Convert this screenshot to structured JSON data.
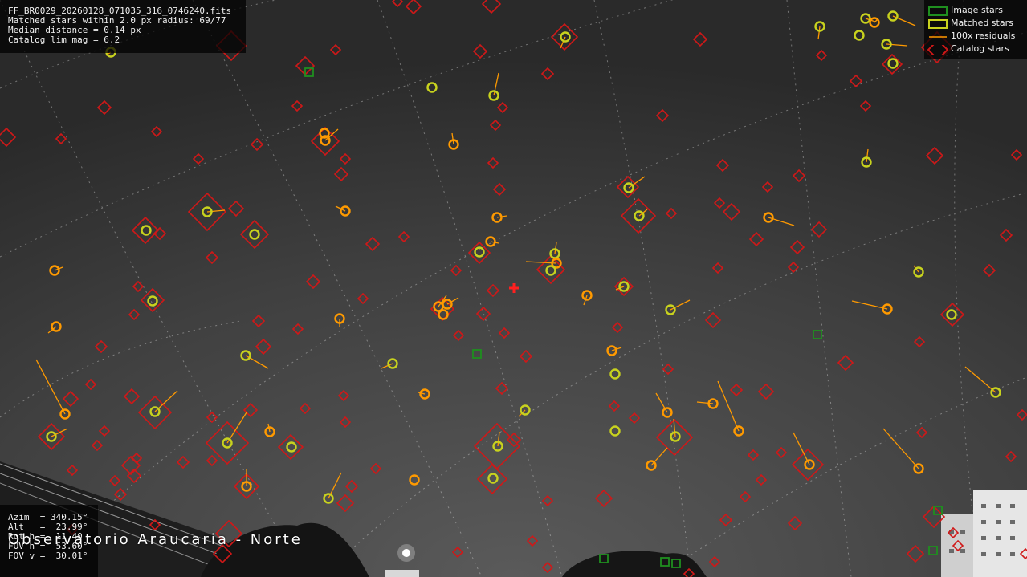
{
  "header": {
    "filename": "FF_BR0029_20260128_071035_316_0746240.fits",
    "matched_line": "Matched stars within 2.0 px radius: 69/77",
    "median_line": "Median distance = 0.14 px",
    "limmag_line": "Catalog lim mag = 6.2"
  },
  "legend": {
    "image_stars": "Image stars",
    "matched_stars": "Matched stars",
    "residuals": "100x residuals",
    "catalog_stars": "Catalog stars"
  },
  "pointing": {
    "azim": "Azim  = 340.15°",
    "alt": "Alt   =  23.99°",
    "rotn": "Rot h =  11.40",
    "fovh": "FOV h =  53.60°",
    "fovv": "FOV v =  30.01°"
  },
  "station_label": "Observatorio Araucaria - Norte",
  "colors": {
    "image_star": "#1f8f1f",
    "matched_star": "#c8d21e",
    "residual": "#ff9a00",
    "catalog_star": "#d01818",
    "center_marker": "#ff2020",
    "grid": "#cfcfcf"
  },
  "icons": {
    "center_marker": "plus-icon"
  }
}
